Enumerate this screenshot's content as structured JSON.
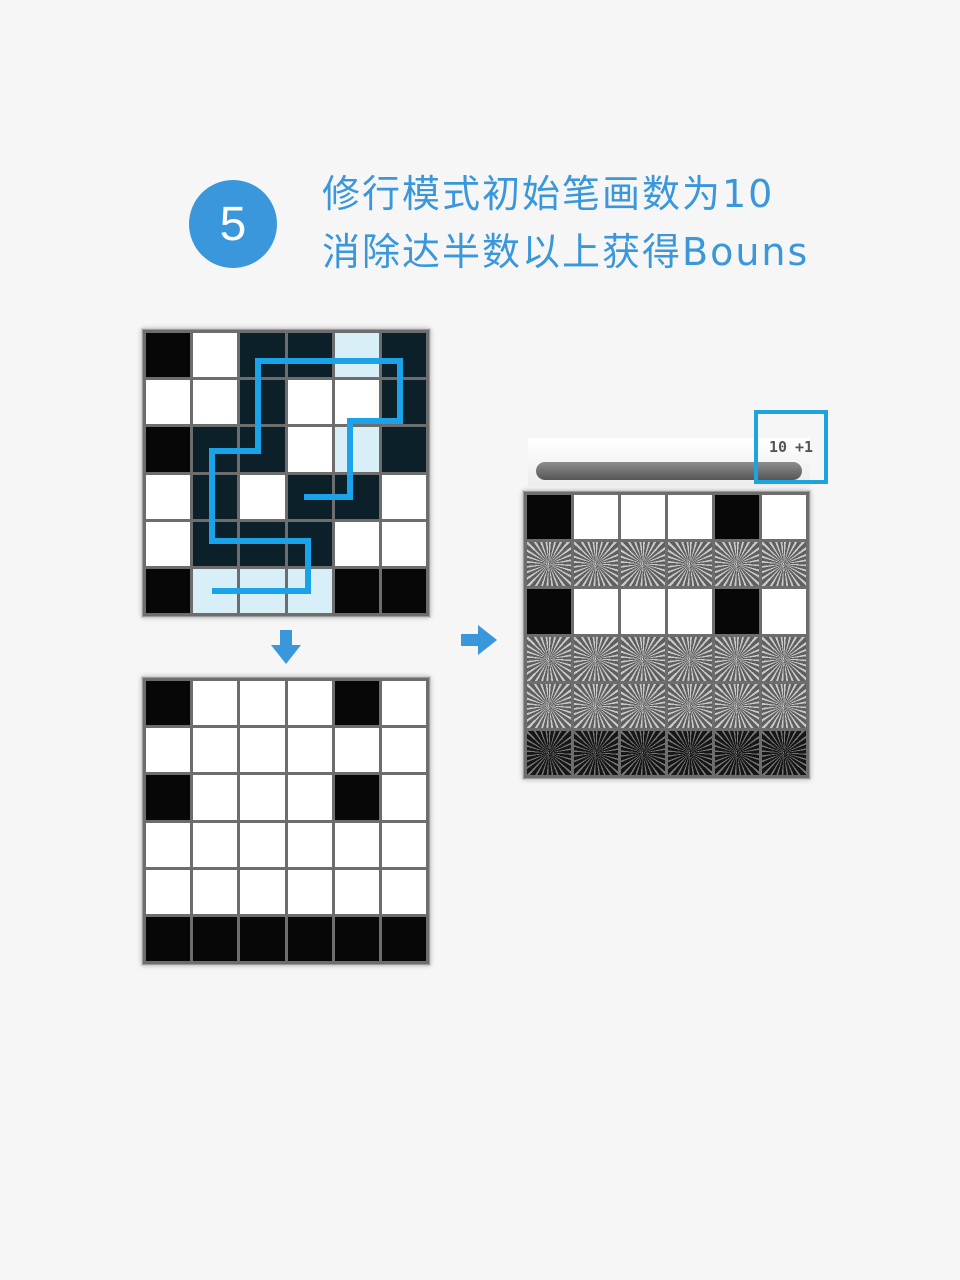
{
  "step": {
    "number": "5",
    "line1": "修行模式初始笔画数为10",
    "line2": "消除达半数以上获得Bouns"
  },
  "colors": {
    "accent": "#3a97dc",
    "path_line": "#1aa3e8",
    "highlight_box": "#1fa3df"
  },
  "boards": {
    "before": {
      "cells": [
        [
          "b",
          "w",
          "p",
          "p",
          "e",
          "p"
        ],
        [
          "w",
          "w",
          "p",
          "w",
          "w",
          "p"
        ],
        [
          "b",
          "p",
          "p",
          "w",
          "e",
          "p"
        ],
        [
          "w",
          "p",
          "w",
          "p",
          "p",
          "w"
        ],
        [
          "w",
          "p",
          "p",
          "p",
          "w",
          "w"
        ],
        [
          "b",
          "e",
          "e",
          "e",
          "b",
          "b"
        ]
      ]
    },
    "after": {
      "cells": [
        [
          "b",
          "w",
          "w",
          "w",
          "b",
          "w"
        ],
        [
          "w",
          "w",
          "w",
          "w",
          "w",
          "w"
        ],
        [
          "b",
          "w",
          "w",
          "w",
          "b",
          "w"
        ],
        [
          "w",
          "w",
          "w",
          "w",
          "w",
          "w"
        ],
        [
          "w",
          "w",
          "w",
          "w",
          "w",
          "w"
        ],
        [
          "b",
          "b",
          "b",
          "b",
          "b",
          "b"
        ]
      ]
    },
    "result": {
      "cells": [
        [
          "b",
          "w",
          "w",
          "w",
          "b",
          "w"
        ],
        [
          "x",
          "x",
          "x",
          "x",
          "x",
          "x"
        ],
        [
          "b",
          "w",
          "w",
          "w",
          "b",
          "w"
        ],
        [
          "x",
          "x",
          "x",
          "x",
          "x",
          "x"
        ],
        [
          "x",
          "x",
          "x",
          "x",
          "x",
          "x"
        ],
        [
          "d",
          "d",
          "d",
          "d",
          "d",
          "d"
        ]
      ]
    }
  },
  "icons": {
    "down_arrow": "arrow-down-icon",
    "right_arrow": "arrow-right-icon"
  },
  "hud": {
    "strokes": "10",
    "bonus": "+1",
    "progress": 1.0
  }
}
